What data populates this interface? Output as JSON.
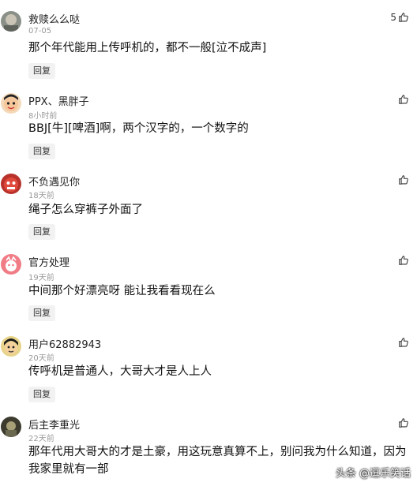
{
  "comments": [
    {
      "username": "救赎么么哒",
      "time": "07-05",
      "text": "那个年代能用上传呼机的，都不一般[泣不成声]",
      "reply": "回复",
      "likes": "5"
    },
    {
      "username": "PPX、黑胖子",
      "time": "8小时前",
      "text": "BBJ[牛][啤酒]啊，两个汉字的，一个数字的",
      "reply": "回复",
      "likes": ""
    },
    {
      "username": "不负遇见你",
      "time": "18天前",
      "text": "绳子怎么穿裤子外面了",
      "reply": "回复",
      "likes": ""
    },
    {
      "username": "官方处理",
      "time": "19天前",
      "text": "中间那个好漂亮呀 能让我看看现在么",
      "reply": "回复",
      "likes": ""
    },
    {
      "username": "用户62882943",
      "time": "20天前",
      "text": "传呼机是普通人，大哥大才是人上人",
      "reply": "回复",
      "likes": ""
    },
    {
      "username": "后主李重光",
      "time": "22天前",
      "text": "那年代用大哥大的才是土豪，用这玩意真算不上，别问我为什么知道，因为我家里就有一部",
      "reply": "",
      "likes": ""
    }
  ],
  "watermark": "头条 @逗乐笑话"
}
